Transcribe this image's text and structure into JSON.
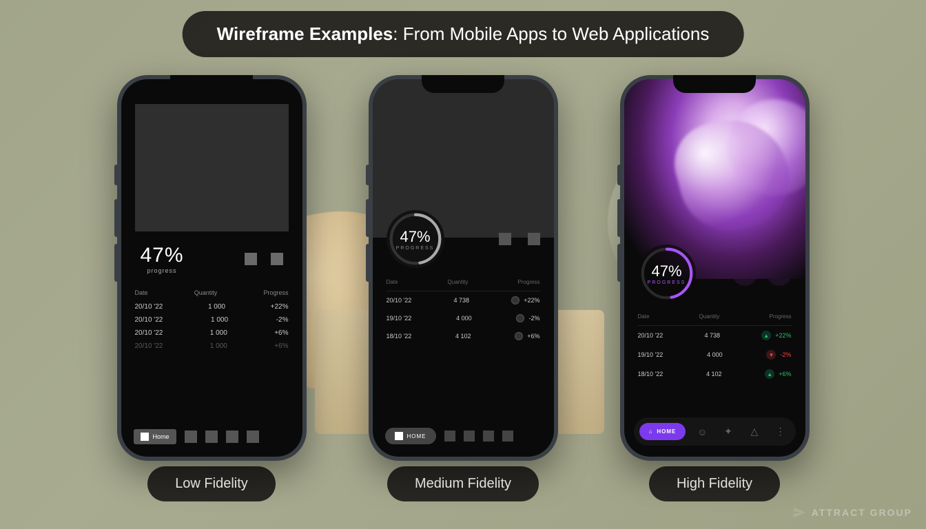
{
  "title_bold": "Wireframe Examples",
  "title_rest": ": From Mobile Apps to Web Applications",
  "labels": {
    "low": "Low Fidelity",
    "med": "Medium Fidelity",
    "high": "High Fidelity"
  },
  "progress": {
    "value": "47%",
    "label_low": "progress",
    "label": "PROGRESS",
    "percent": 47
  },
  "columns": {
    "date": "Date",
    "qty": "Quantity",
    "prog": "Progress"
  },
  "low_rows": [
    {
      "date": "20/10 '22",
      "qty": "1 000",
      "prog": "+22%"
    },
    {
      "date": "20/10 '22",
      "qty": "1 000",
      "prog": "-2%"
    },
    {
      "date": "20/10 '22",
      "qty": "1 000",
      "prog": "+6%"
    },
    {
      "date": "20/10 '22",
      "qty": "1 000",
      "prog": "+6%"
    }
  ],
  "med_rows": [
    {
      "date": "20/10 '22",
      "qty": "4 738",
      "prog": "+22%"
    },
    {
      "date": "19/10 '22",
      "qty": "4 000",
      "prog": "-2%"
    },
    {
      "date": "18/10 '22",
      "qty": "4 102",
      "prog": "+6%"
    }
  ],
  "high_rows": [
    {
      "date": "20/10 '22",
      "qty": "4 738",
      "prog": "+22%",
      "dir": "up"
    },
    {
      "date": "19/10 '22",
      "qty": "4 000",
      "prog": "-2%",
      "dir": "down"
    },
    {
      "date": "18/10 '22",
      "qty": "4 102",
      "prog": "+6%",
      "dir": "up"
    }
  ],
  "nav": {
    "home": "HOME",
    "home_low": "Home"
  },
  "icons": {
    "bolt": "⚡",
    "refresh": "↻",
    "home": "⌂",
    "smile": "☺",
    "sparkle": "✦",
    "bell": "△",
    "dots": "⋮",
    "arrow_up": "▲",
    "arrow_down": "▼"
  },
  "accent": {
    "purple": "#7c3aed",
    "green": "#22c55e",
    "red": "#ef4444"
  },
  "watermark": "ATTRACT GROUP"
}
